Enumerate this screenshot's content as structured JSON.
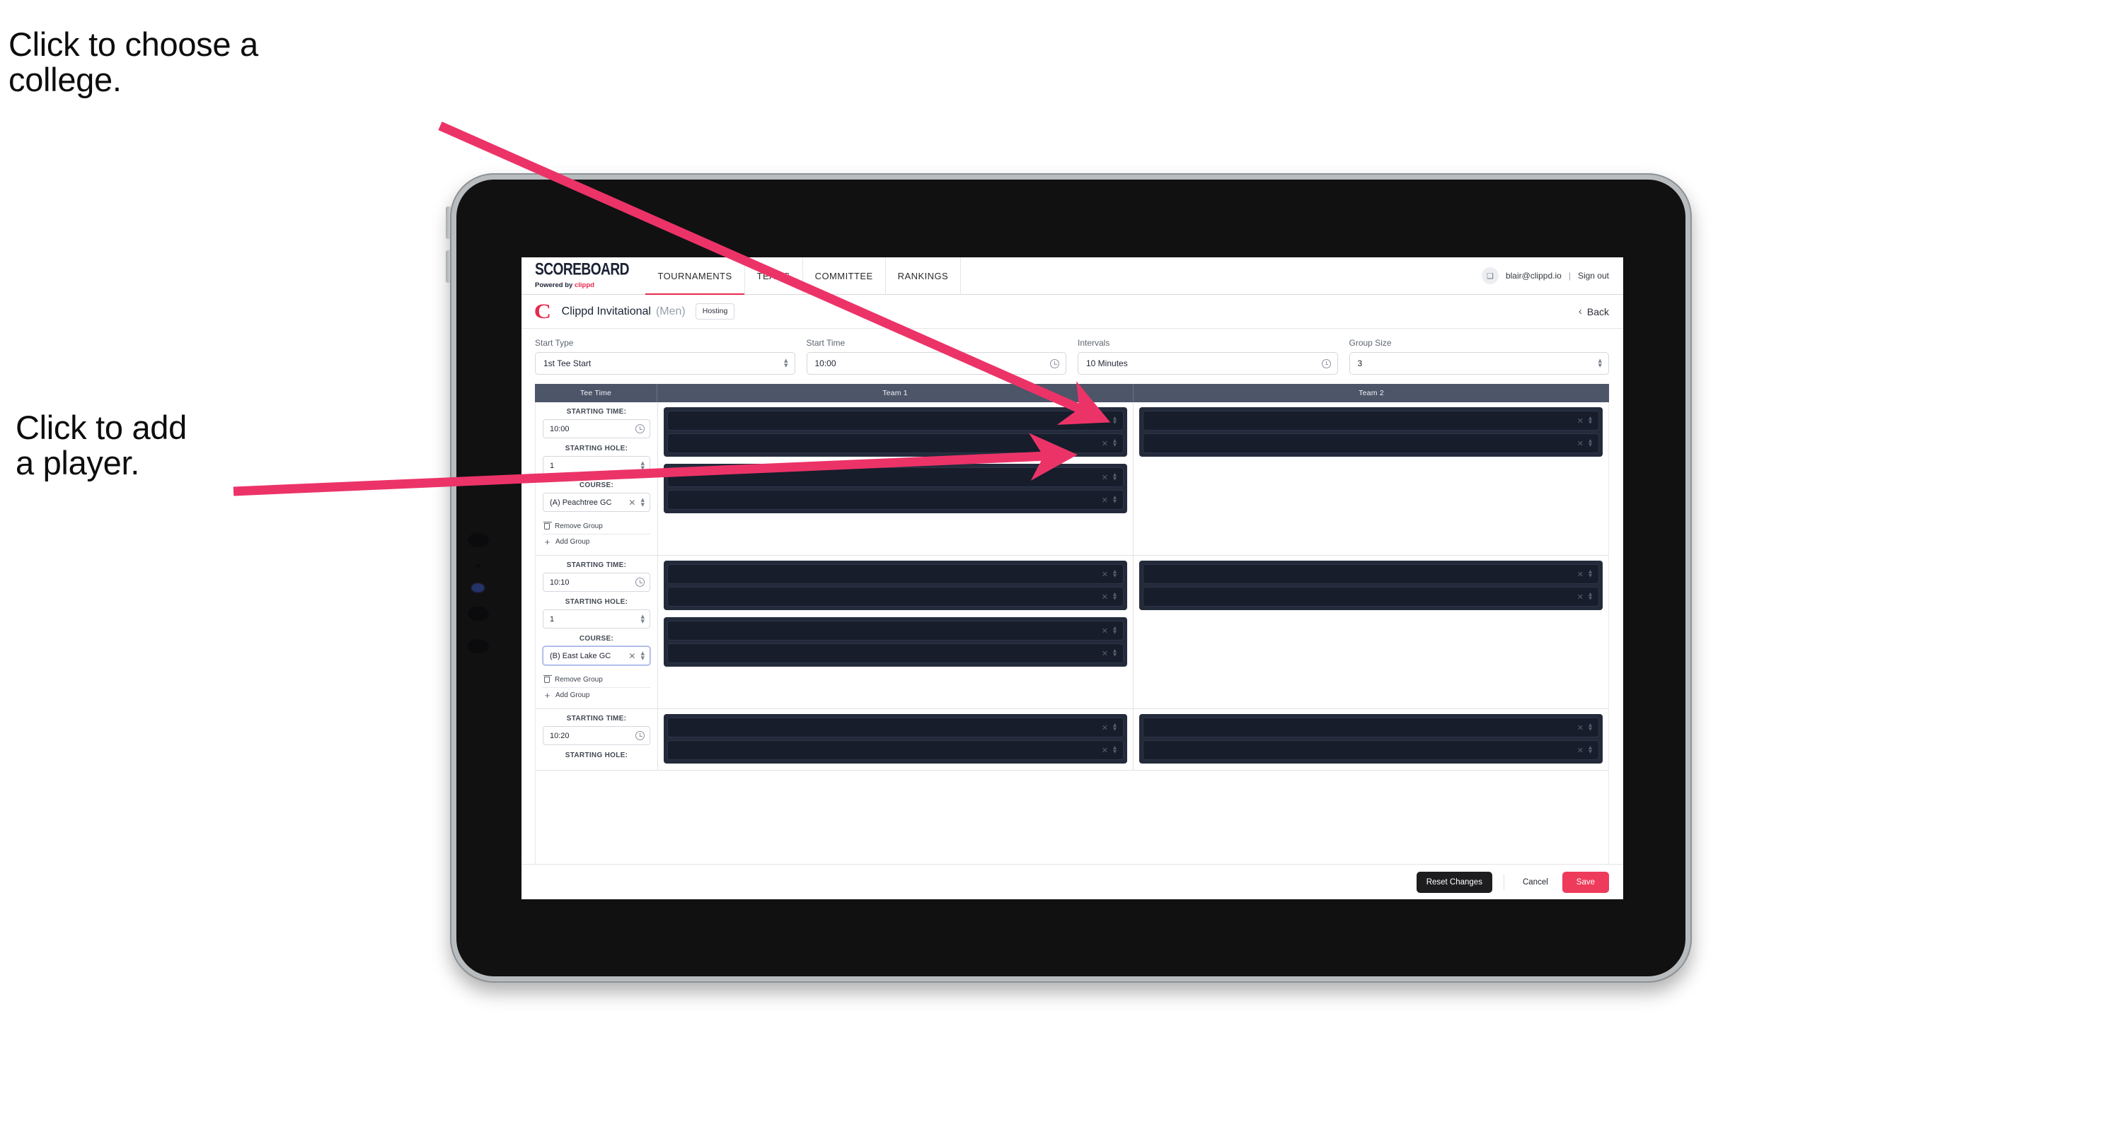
{
  "annotations": [
    {
      "id": "college",
      "text": "Click to choose a\ncollege."
    },
    {
      "id": "player",
      "text": "Click to add\na player."
    }
  ],
  "colors": {
    "accent_pink": "#e8294e",
    "save_pink": "#ef3b5b",
    "table_header": "#4d5569",
    "player_block": "#232b3b",
    "player_row": "#171d2b",
    "dark_button": "#1d1d1f"
  },
  "nav": {
    "brand_word": "SCOREBOARD",
    "brand_sub_prefix": "Powered by ",
    "brand_sub_name": "clippd",
    "tabs": [
      {
        "label": "TOURNAMENTS",
        "active": true
      },
      {
        "label": "TEAMS",
        "active": false
      },
      {
        "label": "COMMITTEE",
        "active": false
      },
      {
        "label": "RANKINGS",
        "active": false
      }
    ],
    "avatar_glyph": "❑",
    "user_email": "blair@clippd.io",
    "separator": "|",
    "sign_out": "Sign out"
  },
  "title_bar": {
    "logo_letter": "C",
    "tournament_name": "Clippd Invitational",
    "gender": "(Men)",
    "badge": "Hosting",
    "back_chevron": "‹",
    "back_label": "Back"
  },
  "controls": [
    {
      "label": "Start Type",
      "value": "1st Tee Start",
      "affordance": "updown"
    },
    {
      "label": "Start Time",
      "value": "10:00",
      "affordance": "clock"
    },
    {
      "label": "Intervals",
      "value": "10 Minutes",
      "affordance": "clock"
    },
    {
      "label": "Group Size",
      "value": "3",
      "affordance": "updown"
    }
  ],
  "table": {
    "headers": {
      "tee_time": "Tee Time",
      "team1": "Team 1",
      "team2": "Team 2"
    },
    "field_labels": {
      "starting_time": "STARTING TIME:",
      "starting_hole": "STARTING HOLE:",
      "course": "COURSE:"
    },
    "actions": {
      "remove_group": "Remove Group",
      "add_group": "Add Group"
    },
    "clear_glyph": "✕",
    "groups": [
      {
        "starting_time": "10:00",
        "starting_hole": "1",
        "course": "(A) Peachtree GC",
        "course_focused": false,
        "team1_blocks": [
          2,
          2
        ],
        "team2_blocks": [
          2
        ]
      },
      {
        "starting_time": "10:10",
        "starting_hole": "1",
        "course": "(B) East Lake GC",
        "course_focused": true,
        "team1_blocks": [
          2,
          2
        ],
        "team2_blocks": [
          2
        ]
      },
      {
        "starting_time": "10:20",
        "starting_hole": "",
        "course": "",
        "course_focused": false,
        "team1_blocks": [
          2
        ],
        "team2_blocks": [
          2
        ],
        "partial": true
      }
    ]
  },
  "footer": {
    "reset_label": "Reset Changes",
    "cancel_label": "Cancel",
    "save_label": "Save"
  }
}
